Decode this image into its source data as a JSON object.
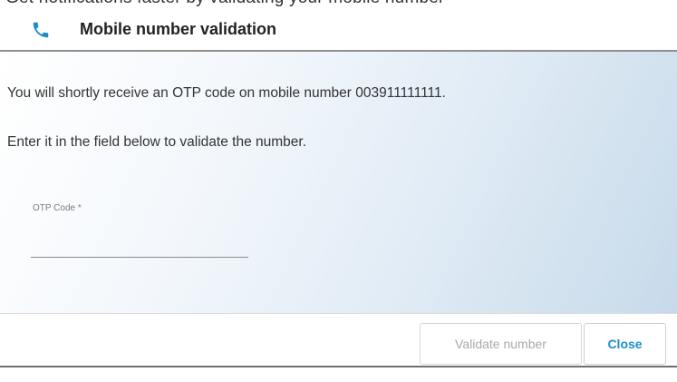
{
  "background_hint": {
    "cutoff_text": "Get notifications faster by validating your mobile number"
  },
  "dialog": {
    "icon": "phone-icon",
    "title": "Mobile number validation",
    "message_line_1": "You will shortly receive an OTP code on mobile number 003911111111.",
    "message_line_2": "Enter it in the field below to validate the number.",
    "otp_field": {
      "label": "OTP Code *",
      "value": "",
      "placeholder": ""
    },
    "buttons": {
      "validate_label": "Validate number",
      "close_label": "Close"
    }
  },
  "colors": {
    "accent": "#1d8ccf",
    "disabled_text": "#a9a9a9",
    "body_gradient_end": "#c7daea"
  }
}
